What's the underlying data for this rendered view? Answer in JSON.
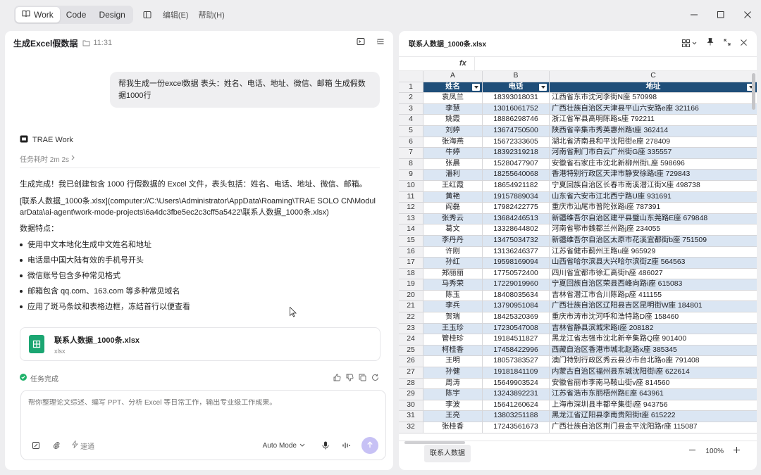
{
  "titlebar": {
    "modes": [
      "Work",
      "Code",
      "Design"
    ],
    "menus": [
      "编辑(E)",
      "帮助(H)"
    ]
  },
  "chat": {
    "title": "生成Excel假数据",
    "time": "11:31",
    "user_message": "帮我生成一份excel数据  表头：姓名、电话、地址、微信、邮箱   生成假数据1000行",
    "agent_name": "TRAE Work",
    "task_time": "任务耗时 2m 2s",
    "reply_intro": "生成完成！我已创建包含 1000 行假数据的 Excel 文件，表头包括：姓名、电话、地址、微信、邮箱。",
    "reply_path": "[联系人数据_1000条.xlsx](computer://C:\\Users\\Administrator\\AppData\\Roaming\\TRAE SOLO CN\\ModularData\\ai-agent\\work-mode-projects\\6a4dc3fbe5ec2c3cff5a5422\\联系人数据_1000条.xlsx)",
    "features_title": "数据特点：",
    "features": [
      "使用中文本地化生成中文姓名和地址",
      "电话是中国大陆有效的手机号开头",
      "微信账号包含多种常见格式",
      "邮箱包含 qq.com、163.com 等多种常见域名",
      "应用了斑马条纹和表格边框，冻结首行以便查看"
    ],
    "file_name": "联系人数据_1000条.xlsx",
    "file_ext": "xlsx",
    "task_status": "任务完成",
    "input_placeholder": "帮你整理论文综述、编写 PPT、分析 Excel 等日常工作，输出专业级工作成果。",
    "speed_label": "速通",
    "mode_label": "Auto Mode"
  },
  "sheet": {
    "file_title": "联系人数据_1000条.xlsx",
    "fx_label": "fx",
    "columns": [
      "A",
      "B",
      "C"
    ],
    "headers": [
      "姓名",
      "电话",
      "地址"
    ],
    "rows": [
      [
        "袁凤兰",
        "18393018031",
        "江西省东市沈河李街N座 570998"
      ],
      [
        "李慧",
        "13016061752",
        "广西壮族自治区天津县平山六安路e座 321166"
      ],
      [
        "姚霞",
        "18886298746",
        "浙江省军县高明陈路s座 792211"
      ],
      [
        "刘婷",
        "13674750500",
        "陕西省辛集市秀英惠州路t座 362414"
      ],
      [
        "张海燕",
        "15672333605",
        "湖北省济南县和平沈阳街e座 278409"
      ],
      [
        "牛婷",
        "18392319218",
        "河南省荆门市白云广州街G座 335557"
      ],
      [
        "张晨",
        "15280477907",
        "安徽省石家庄市沈北新柳州街L座 598696"
      ],
      [
        "潘利",
        "18255640068",
        "香港特别行政区天津市静安徐路t座 729843"
      ],
      [
        "王红霞",
        "18654921182",
        "宁夏回族自治区长春市南溪潜江街X座 498738"
      ],
      [
        "黄艳",
        "19157889034",
        "山东省六安市江北西宁路U座 931691"
      ],
      [
        "阎磊",
        "17982422775",
        "重庆市汕尾市普陀张路i座 787391"
      ],
      [
        "张秀云",
        "13684246513",
        "新疆维吾尔自治区建平县璧山东莞路E座 679848"
      ],
      [
        "葛文",
        "13328644802",
        "河南省鄂市魏都兰州路j座 234055"
      ],
      [
        "李丹丹",
        "13475034732",
        "新疆维吾尔自治区太原市花溪宜都街b座 751509"
      ],
      [
        "许刚",
        "13136246377",
        "江苏省健市蓟州王路u座 965929"
      ],
      [
        "孙红",
        "19598169094",
        "山西省哈尔滨县大兴哈尔滨街Z座 564563"
      ],
      [
        "郑丽丽",
        "17750572400",
        "四川省宜都市徐汇高街h座 486027"
      ],
      [
        "马秀荣",
        "17229019960",
        "宁夏回族自治区荣县西峰向路i座 615083"
      ],
      [
        "陈玉",
        "18408035634",
        "吉林省潜江市合川陈路p座 411155"
      ],
      [
        "李兵",
        "13790951084",
        "广西壮族自治区辽阳县吉区昆明街W座 184801"
      ],
      [
        "贺瑞",
        "18425320369",
        "重庆市涛市沈河呼和浩特路D座 158460"
      ],
      [
        "王玉珍",
        "17230547008",
        "吉林省静县滨城宋路I座 208182"
      ],
      [
        "管桂珍",
        "19184511827",
        "黑龙江省志强市沈北新辛集路Q座 901400"
      ],
      [
        "柯桂香",
        "17458422996",
        "西藏自治区香港市城北赵路x座 385345"
      ],
      [
        "王明",
        "18057383527",
        "澳门特别行政区秀云县沙市台北路o座 791408"
      ],
      [
        "孙健",
        "19181841109",
        "内蒙古自治区福州县东城沈阳街i座 622614"
      ],
      [
        "周涛",
        "15649903524",
        "安徽省丽市李南马鞍山街v座 814560"
      ],
      [
        "陈宇",
        "13243892231",
        "江苏省浩市东丽梧州路E座 643961"
      ],
      [
        "李波",
        "15641260624",
        "上海市深圳县丰都辛集街i座 943756"
      ],
      [
        "王亮",
        "13803251188",
        "黑龙江省辽阳县李南贵阳街t座 615222"
      ],
      [
        "张桂香",
        "17243561673",
        "广西壮族自治区荆门县金平沈阳路r座 115087"
      ]
    ],
    "sheet_tab": "联系人数据",
    "zoom": "100%"
  }
}
